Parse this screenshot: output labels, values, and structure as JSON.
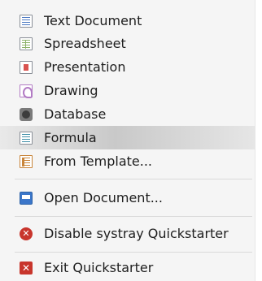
{
  "menu": {
    "items": [
      {
        "label": "Text Document",
        "icon": "writer-doc-icon"
      },
      {
        "label": "Spreadsheet",
        "icon": "calc-doc-icon"
      },
      {
        "label": "Presentation",
        "icon": "impress-doc-icon"
      },
      {
        "label": "Drawing",
        "icon": "draw-doc-icon"
      },
      {
        "label": "Database",
        "icon": "database-icon"
      },
      {
        "label": "Formula",
        "icon": "math-doc-icon",
        "highlighted": true
      },
      {
        "label": "From Template...",
        "icon": "template-icon"
      }
    ],
    "open_document": {
      "label": "Open Document...",
      "icon": "open-folder-icon"
    },
    "disable_quickstarter": {
      "label": "Disable systray Quickstarter",
      "icon": "no-entry-icon"
    },
    "exit_quickstarter": {
      "label": "Exit Quickstarter",
      "icon": "close-x-icon"
    }
  },
  "colors": {
    "menu_background": "#f5f5f5",
    "highlight": "#c9c9c9",
    "text": "#1e1e1e",
    "danger": "#c8352c"
  }
}
